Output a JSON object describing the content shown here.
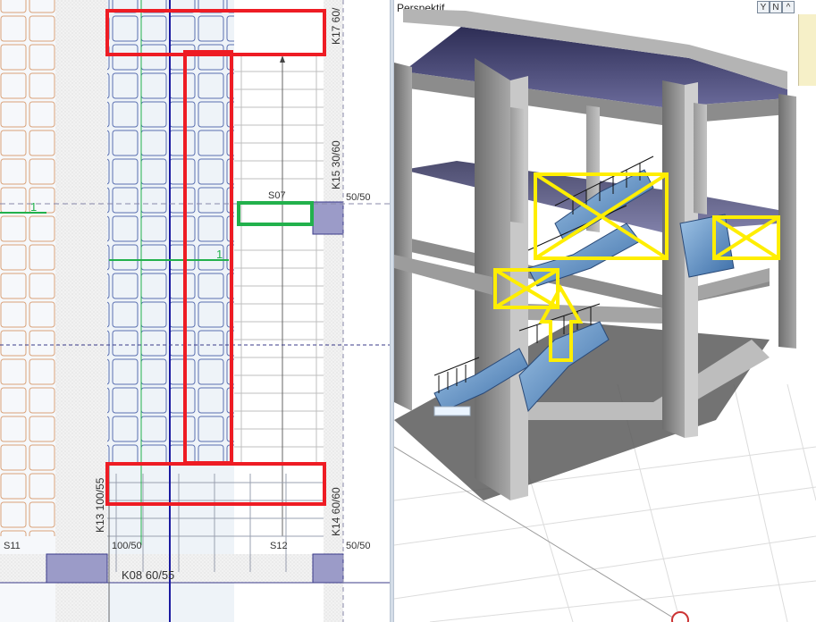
{
  "plan": {
    "labels": {
      "k17": "K17 60/",
      "k15": "K15 30/60",
      "k14": "K14 60/60",
      "k13": "K13 100/55",
      "k08": "K08 60/55",
      "s07": "S07",
      "s11": "S11",
      "s12": "S12",
      "dim_right_top": "50/50",
      "dim_right_bottom": "50/50",
      "dim_left_bottom": "100/50",
      "axis_1_left": "1",
      "axis_1_mid": "1"
    }
  },
  "perspective": {
    "collapse_button": "^",
    "title": "Perspektif",
    "filter_button": "Y",
    "north_button": "N",
    "up_button": "^"
  },
  "colors": {
    "highlight_red": "#ee1c24",
    "highlight_yellow": "#ffee00",
    "highlight_green": "#22b14c",
    "axis_blue": "#1a1aa0",
    "column_fill": "#9b9bc8"
  }
}
